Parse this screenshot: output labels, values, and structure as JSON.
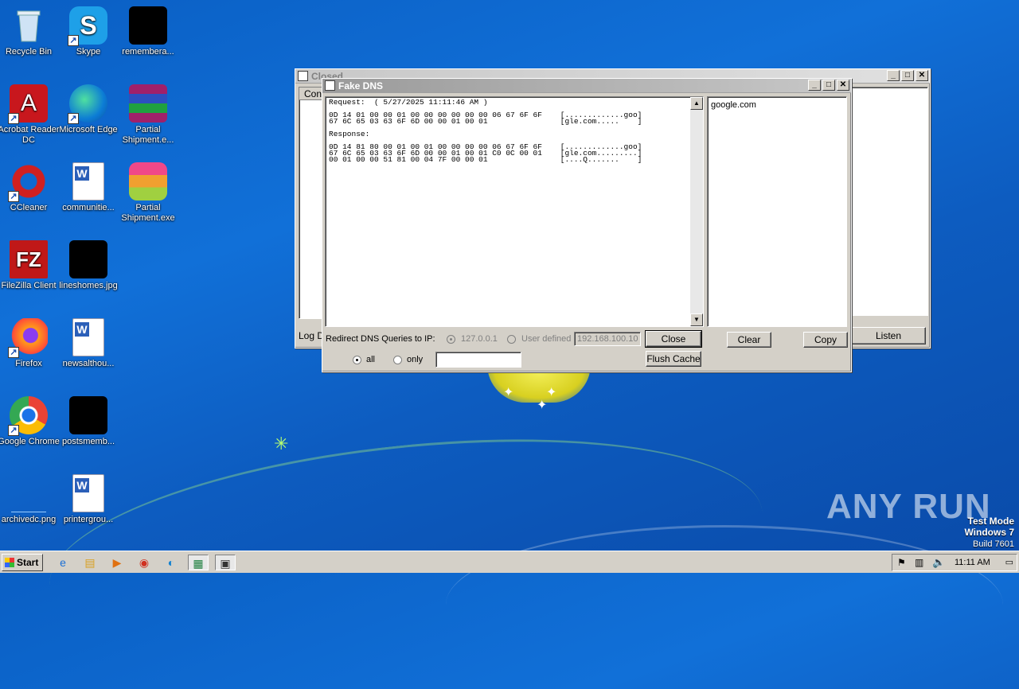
{
  "desktop": {
    "icons": [
      {
        "label": "Recycle Bin",
        "glyph": "trash-icon"
      },
      {
        "label": "Skype",
        "glyph": "skype-icon"
      },
      {
        "label": "remembera...",
        "glyph": "black-thumbnail"
      },
      {
        "label": "Acrobat Reader DC",
        "glyph": "acrobat-icon"
      },
      {
        "label": "Microsoft Edge",
        "glyph": "edge-icon"
      },
      {
        "label": "Partial Shipment.e...",
        "glyph": "winrar-icon"
      },
      {
        "label": "CCleaner",
        "glyph": "ccleaner-icon"
      },
      {
        "label": "communitie...",
        "glyph": "word-doc-icon"
      },
      {
        "label": "Partial Shipment.exe",
        "glyph": "app-icon"
      },
      {
        "label": "FileZilla Client",
        "glyph": "filezilla-icon"
      },
      {
        "label": "lineshomes.jpg",
        "glyph": "black-thumbnail"
      },
      {
        "label": "Firefox",
        "glyph": "firefox-icon"
      },
      {
        "label": "newsalthou...",
        "glyph": "word-doc-icon"
      },
      {
        "label": "Google Chrome",
        "glyph": "chrome-icon"
      },
      {
        "label": "postsmemb...",
        "glyph": "black-thumbnail"
      },
      {
        "label": "archivedc.png",
        "glyph": "png-thumbnail"
      },
      {
        "label": "printergrou...",
        "glyph": "word-doc-icon"
      }
    ]
  },
  "back_window": {
    "title": "Closed",
    "column_header": "Conn",
    "log_label": "Log D",
    "listen_button": "Listen"
  },
  "fake_dns": {
    "title": "Fake DNS",
    "log_lines": [
      "Request:  ( 5/27/2025 11:11:46 AM )",
      "",
      "0D 14 01 00 00 01 00 00 00 00 00 00 06 67 6F 6F    [.............goo]",
      "67 6C 65 03 63 6F 6D 00 00 01 00 01                [gle.com.....    ]",
      "",
      "Response:",
      "",
      "0D 14 81 80 00 01 00 01 00 00 00 00 06 67 6F 6F    [.............goo]",
      "67 6C 65 03 63 6F 6D 00 00 01 00 01 C0 0C 00 01    [gle.com.........]",
      "00 01 00 00 51 81 00 04 7F 00 00 01                [....Q.......    ]"
    ],
    "domains": [
      "google.com"
    ],
    "redirect_label": "Redirect DNS Queries to IP:",
    "opt_localhost": "127.0.0.1",
    "opt_user_defined": "User defined",
    "ip_value": "192.168.100.10",
    "close_button": "Close",
    "flush_button": "Flush Cache",
    "clear_button": "Clear",
    "copy_button": "Copy",
    "radio_all": "all",
    "radio_only": "only",
    "only_value": ""
  },
  "taskbar": {
    "start_label": "Start",
    "clock": "11:11 AM",
    "pinned": [
      "ie-icon",
      "explorer-icon",
      "media-player-icon",
      "chrome-icon",
      "edge-icon",
      "fakenet-icon",
      "fake-dns-icon"
    ]
  },
  "watermark": {
    "brand": "ANY RUN",
    "line1": "Test Mode",
    "line2": "Windows 7",
    "line3": "Build 7601"
  }
}
